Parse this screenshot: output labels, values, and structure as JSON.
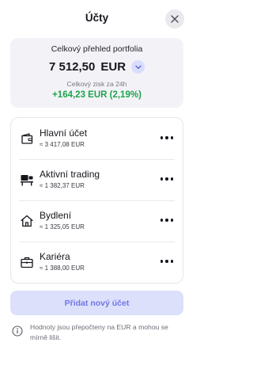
{
  "header": {
    "title": "Účty",
    "close_icon": "close-icon"
  },
  "summary": {
    "label": "Celkový přehled portfolia",
    "amount": "7 512,50",
    "currency": "EUR",
    "currency_toggle_icon": "chevron-down-icon",
    "profit_label": "Celkový zisk za 24h",
    "profit_value": "+164,23 EUR (2,19%)",
    "profit_color": "#1fa34e"
  },
  "accounts": [
    {
      "name": "Hlavní účet",
      "balance": "≈ 3 417,08 EUR",
      "icon": "wallet-icon"
    },
    {
      "name": "Aktivní trading",
      "balance": "≈ 1 382,37 EUR",
      "icon": "trading-desk-icon"
    },
    {
      "name": "Bydlení",
      "balance": "≈ 1 325,05 EUR",
      "icon": "house-icon"
    },
    {
      "name": "Kariéra",
      "balance": "≈ 1 388,00 EUR",
      "icon": "briefcase-icon"
    }
  ],
  "add_button": {
    "label": "Přidat nový účet",
    "accent": "#6f76e6"
  },
  "note": {
    "icon": "info-icon",
    "text": "Hodnoty jsou přepočteny na EUR a mohou se mírně lišit."
  }
}
